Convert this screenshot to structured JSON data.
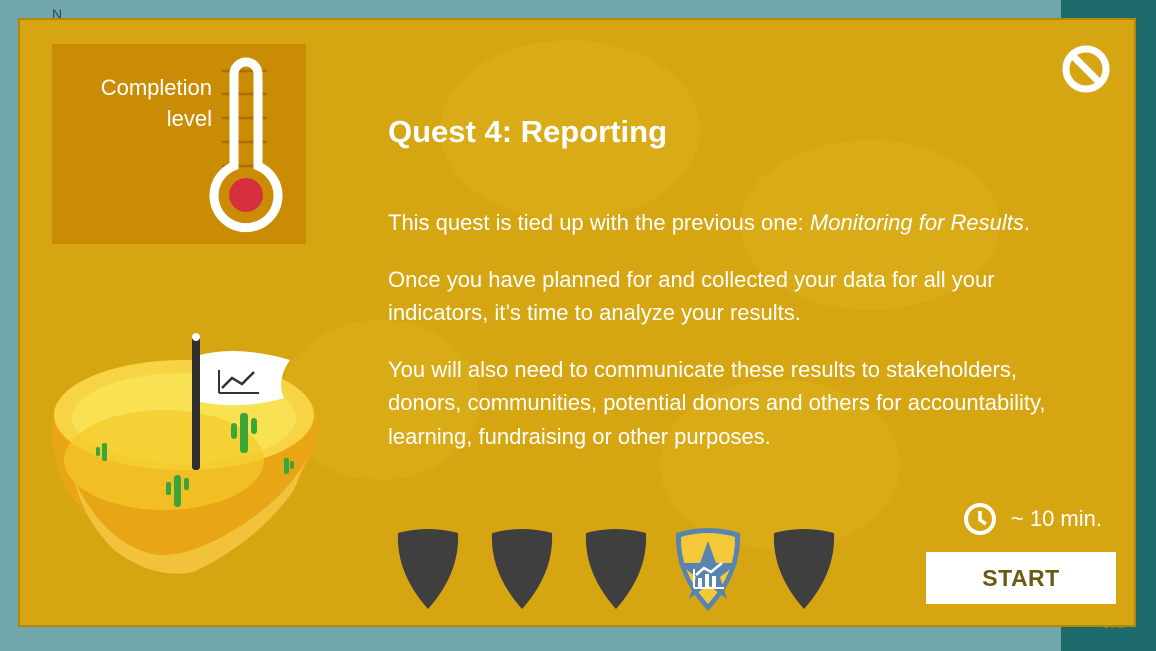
{
  "background": {
    "corner_letter": "N",
    "progress_counter": "0/5"
  },
  "completion": {
    "label_line1": "Completion",
    "label_line2": "level"
  },
  "quest": {
    "title": "Quest 4: Reporting",
    "para1_prefix": "This quest is tied up with the previous one: ",
    "para1_link": "Monitoring for Results",
    "para1_suffix": ".",
    "para2": "Once you have planned for and collected your data for all your indicators, it’s time to analyze your results.",
    "para3": "You will also need to communicate these results to stakeholders, donors, communities, potential donors and others for accountability, learning, fundraising or other purposes."
  },
  "badges": [
    {
      "state": "locked",
      "icon": "shield-icon"
    },
    {
      "state": "locked",
      "icon": "shield-icon"
    },
    {
      "state": "locked",
      "icon": "shield-icon"
    },
    {
      "state": "current",
      "icon": "chart-star-shield-icon"
    },
    {
      "state": "locked",
      "icon": "shield-icon"
    }
  ],
  "duration": "~ 10 min.",
  "start_label": "START",
  "colors": {
    "modal_bg": "#d6a612",
    "completion_box": "#cb8c05",
    "thermometer_bulb": "#d6303c",
    "badge_locked": "#3f3f3f",
    "badge_active": "#f5c83a",
    "start_text": "#6b5a12"
  }
}
